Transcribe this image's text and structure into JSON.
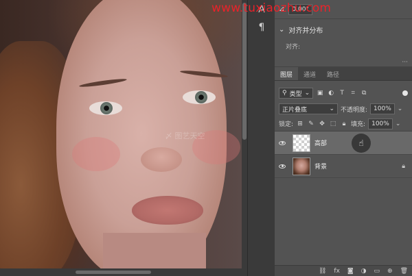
{
  "properties": {
    "angle_value": "0.00°",
    "watermark_url": "www.tuxiaozhu.com"
  },
  "align": {
    "title": "对齐并分布",
    "subtitle": "对齐:",
    "more_dots": "···"
  },
  "canvas": {
    "watermark_text": "〆 图艺天空"
  },
  "layers_panel": {
    "tabs": [
      "图层",
      "通道",
      "路径"
    ],
    "filter_kind": "类型",
    "blend_mode": "正片叠底",
    "opacity_label": "不透明度:",
    "opacity_value": "100%",
    "lock_label": "锁定:",
    "fill_label": "填充:",
    "fill_value": "100%",
    "layers": [
      {
        "name": "高部",
        "selected": true
      },
      {
        "name": "背景",
        "selected": false
      }
    ],
    "footer_icons": [
      "link-icon",
      "fx-icon",
      "mask-icon",
      "adjustment-icon",
      "group-icon",
      "new-layer-icon",
      "trash-icon"
    ]
  },
  "colors": {
    "accent_red": "#e8232a",
    "panel_bg": "#535353",
    "selected_layer": "#696969"
  }
}
